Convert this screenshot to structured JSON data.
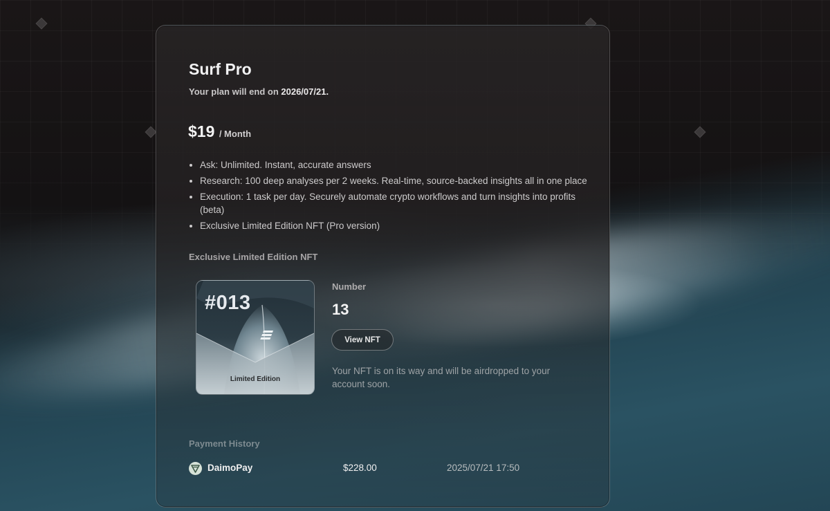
{
  "plan": {
    "title": "Surf Pro",
    "end_prefix": "Your plan will end on ",
    "end_date": "2026/07/21.",
    "price": "$19",
    "period": "/ Month"
  },
  "features": [
    "Ask: Unlimited. Instant, accurate answers",
    "Research: 100 deep analyses per 2 weeks. Real-time, source-backed insights all in one place",
    "Execution: 1 task per day. Securely automate crypto workflows and turn insights into profits (beta)",
    "Exclusive Limited Edition NFT (Pro version)"
  ],
  "nft": {
    "heading": "Exclusive Limited Edition NFT",
    "card_number": "#013",
    "card_edition": "Limited Edition",
    "number_label": "Number",
    "number_value": "13",
    "view_button": "View NFT",
    "note": "Your NFT is on its way and will be airdropped to your account soon."
  },
  "payment_history": {
    "heading": "Payment History",
    "rows": [
      {
        "icon": "daimopay-icon",
        "method": "DaimoPay",
        "amount": "$228.00",
        "date": "2025/07/21 17:50"
      }
    ]
  }
}
